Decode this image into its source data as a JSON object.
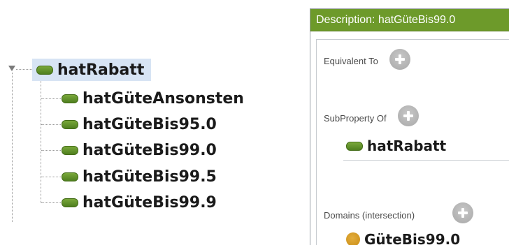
{
  "tree": {
    "root": {
      "label": "hatRabatt",
      "icon": "object-property-icon"
    },
    "children": [
      {
        "label": "hatGüteAnsonsten"
      },
      {
        "label": "hatGüteBis95.0"
      },
      {
        "label": "hatGüteBis99.0"
      },
      {
        "label": "hatGüteBis99.5"
      },
      {
        "label": "hatGüteBis99.9"
      }
    ]
  },
  "description_panel": {
    "title": "Description: hatGüteBis99.0",
    "header_color": "#6d9a2a",
    "sections": {
      "equivalent_to": {
        "label": "Equivalent To"
      },
      "subproperty_of": {
        "label": "SubProperty Of",
        "entries": [
          "hatRabatt"
        ]
      },
      "domains": {
        "label": "Domains (intersection)",
        "entries": [
          "GüteBis99.0"
        ]
      }
    }
  },
  "colors": {
    "property_green": "#5b8c26",
    "class_orange": "#d69a22",
    "selection_blue": "#d7e4f4"
  }
}
